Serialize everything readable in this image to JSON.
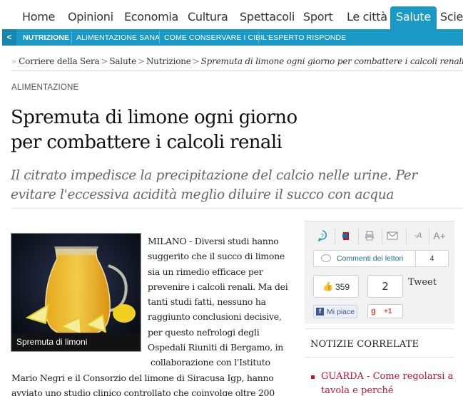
{
  "topnav": {
    "items": [
      "Home",
      "Opinioni",
      "Economia",
      "Cultura",
      "Spettacoli",
      "Sport",
      "Le città",
      "Salute",
      "Scien"
    ],
    "active": "Salute",
    "accent": "#1b99c6"
  },
  "subnav": {
    "back_icon": "chevron-left",
    "items": [
      "NUTRIZIONE",
      "ALIMENTAZIONE SANA",
      "COME CONSERVARE I CIBI",
      "L'ESPERTO RISPONDE"
    ]
  },
  "breadcrumb": {
    "items": [
      "Corriere della Sera",
      "Salute",
      "Nutrizione"
    ],
    "current": "Spremuta di limone ogni giorno per combattere i calcoli renali"
  },
  "article": {
    "section": "ALIMENTAZIONE",
    "title_line1": "Spremuta di limone ogni giorno",
    "title_line2": "per combattere i calcoli renali",
    "subtitle_line1": "Il citrato impedisce la precipitazione del calcio nelle urine. Per",
    "subtitle_line2": "evitare l'eccessiva acidità meglio diluire il succo con acqua",
    "image_caption": "Spremuta di limoni",
    "body_lines_right": [
      "MILANO - Diversi studi hanno",
      "suggerito che il succo di limone",
      "sia un rimedio efficace per",
      "prevenire i calcoli renali. Ma dei",
      "tanti studi fatti, nessuno ha",
      "raggiunto conclusioni decisive,",
      "per questo nefrologi degli",
      "Ospedali Riuniti di Bergamo, in",
      "collaborazione con l'Istituto"
    ],
    "body_lines_full": [
      "Mario Negri e il Consorzio del limone di Siracusa Igp, hanno",
      "avviato uno studio clinico controllato che coinvolge oltre 200"
    ]
  },
  "share": {
    "tools": [
      "help-icon",
      "audio-icon",
      "print-icon",
      "email-icon",
      "font-smaller-icon",
      "font-larger-icon"
    ],
    "font_smaller": "-A",
    "font_larger": "A+",
    "comments_label": "Commenti dei lettori",
    "comments_count": "4",
    "facebook_count": "359",
    "facebook_like": "Mi piace",
    "tweet_count": "2",
    "tweet_label": "Tweet",
    "gplus_label": "+1"
  },
  "related": {
    "title": "NOTIZIE CORRELATE",
    "items": [
      "GUARDA - Come regolarsi a tavola e perché"
    ],
    "item_line1": "GUARDA - Come regolarsi a",
    "item_line2": "tavola e perché"
  }
}
